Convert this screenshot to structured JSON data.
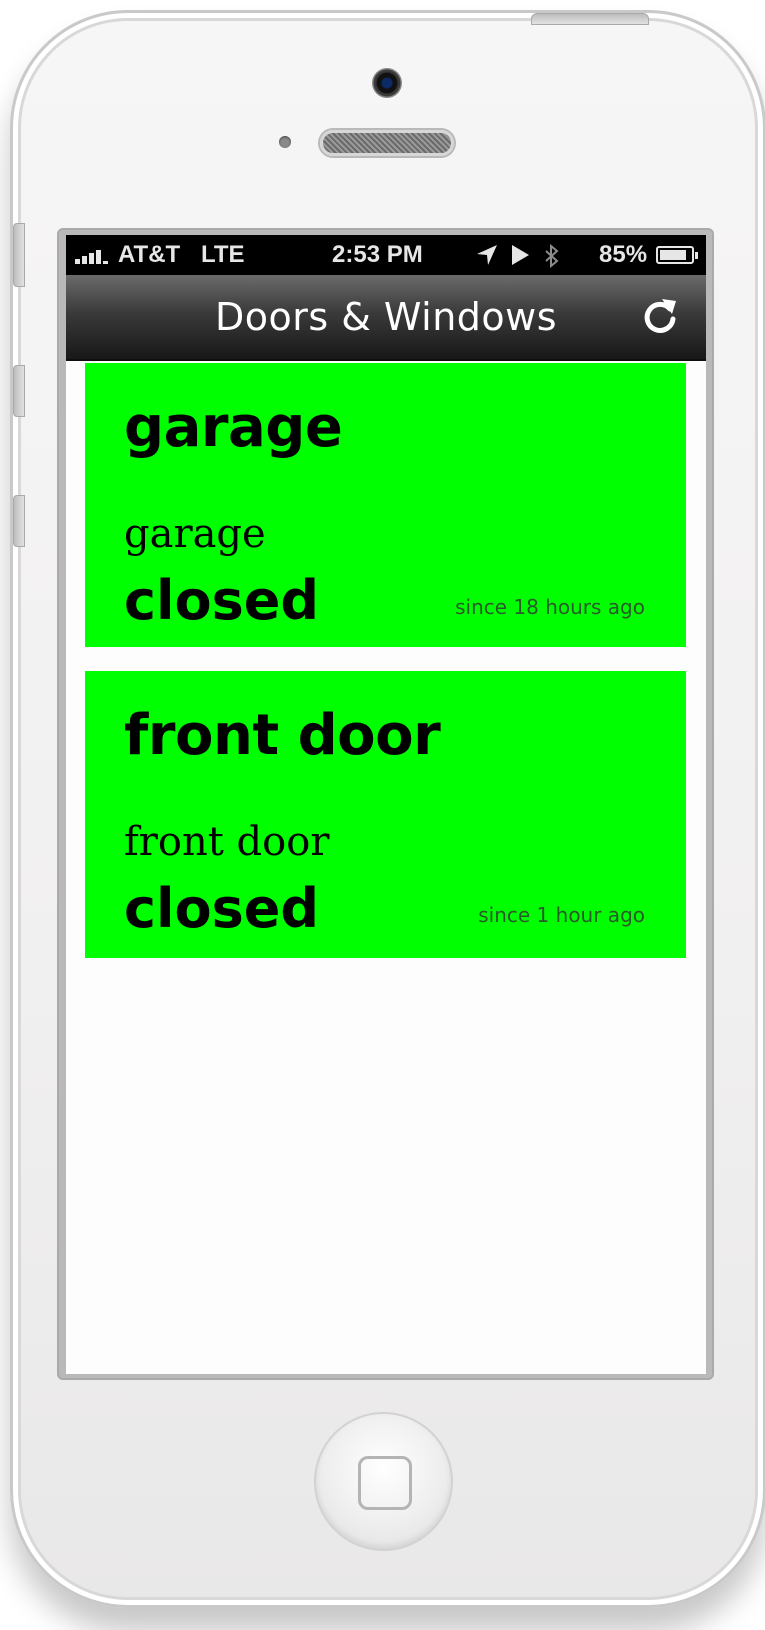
{
  "statusbar": {
    "carrier": "AT&T",
    "network": "LTE",
    "time": "2:53 PM",
    "battery_percent_text": "85%",
    "battery_level": 0.85,
    "icons": [
      "signal-icon",
      "location-arrow-icon",
      "play-icon",
      "bluetooth-icon",
      "battery-icon"
    ]
  },
  "navbar": {
    "title": "Doors & Windows",
    "refresh_icon": "refresh-icon"
  },
  "sensors": [
    {
      "title": "garage",
      "subtitle": "garage",
      "state": "closed",
      "since": "since 18 hours ago",
      "color": "#00ff00"
    },
    {
      "title": "front door",
      "subtitle": "front door",
      "state": "closed",
      "since": "since 1 hour ago",
      "color": "#00ff00"
    }
  ],
  "device": {
    "home_button_icon": "home-square-icon"
  }
}
